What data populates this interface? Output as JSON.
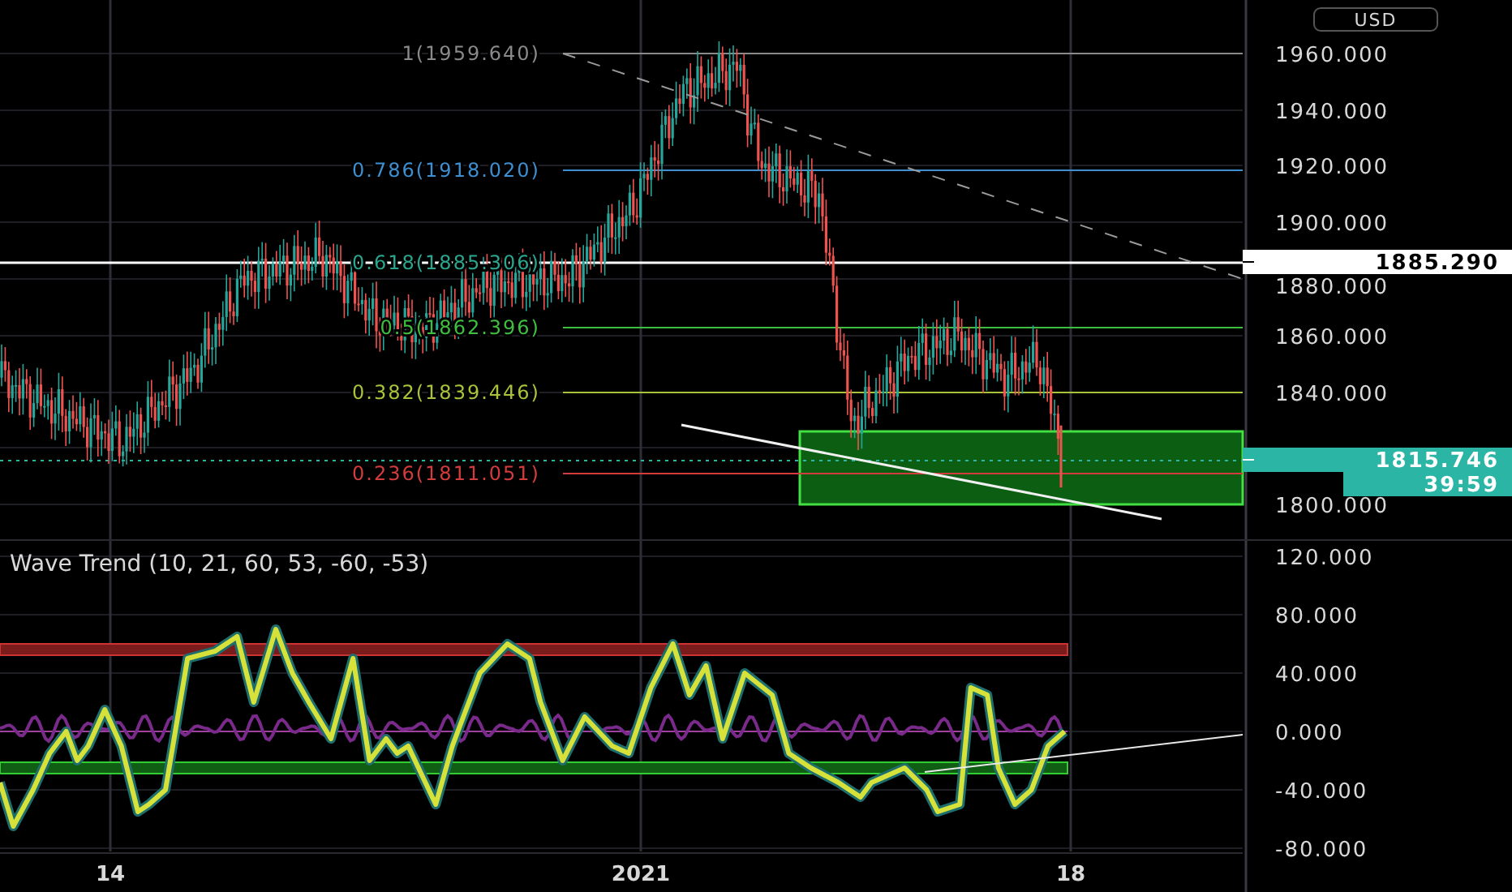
{
  "currency": "USD",
  "fib_levels": [
    {
      "label": "1(1959.640)",
      "color": "#8a8a8a"
    },
    {
      "label": "0.786(1918.020)",
      "color": "#3d8fd1"
    },
    {
      "label": "0.618(1885.306)",
      "color": "#2aa68f"
    },
    {
      "label": "0.5(1862.396)",
      "color": "#3fbf3f"
    },
    {
      "label": "0.382(1839.446)",
      "color": "#a8c23a"
    },
    {
      "label": "0.236(1811.051)",
      "color": "#d23c3c"
    }
  ],
  "price_axis": [
    "1960.000",
    "1940.000",
    "1920.000",
    "1900.000",
    "1880.000",
    "1860.000",
    "1840.000",
    "1800.000"
  ],
  "price_markers": [
    {
      "kind": "line",
      "text": "1885.290"
    },
    {
      "kind": "last",
      "text": "1815.746"
    },
    {
      "kind": "countdown",
      "text": "39:59"
    }
  ],
  "indicator": {
    "title": "Wave Trend (10, 21, 60, 53, -60, -53)",
    "axis": [
      "120.000",
      "80.000",
      "40.000",
      "0.000",
      "-40.000",
      "-80.000"
    ]
  },
  "time_axis": [
    "14",
    "2021",
    "18"
  ]
}
